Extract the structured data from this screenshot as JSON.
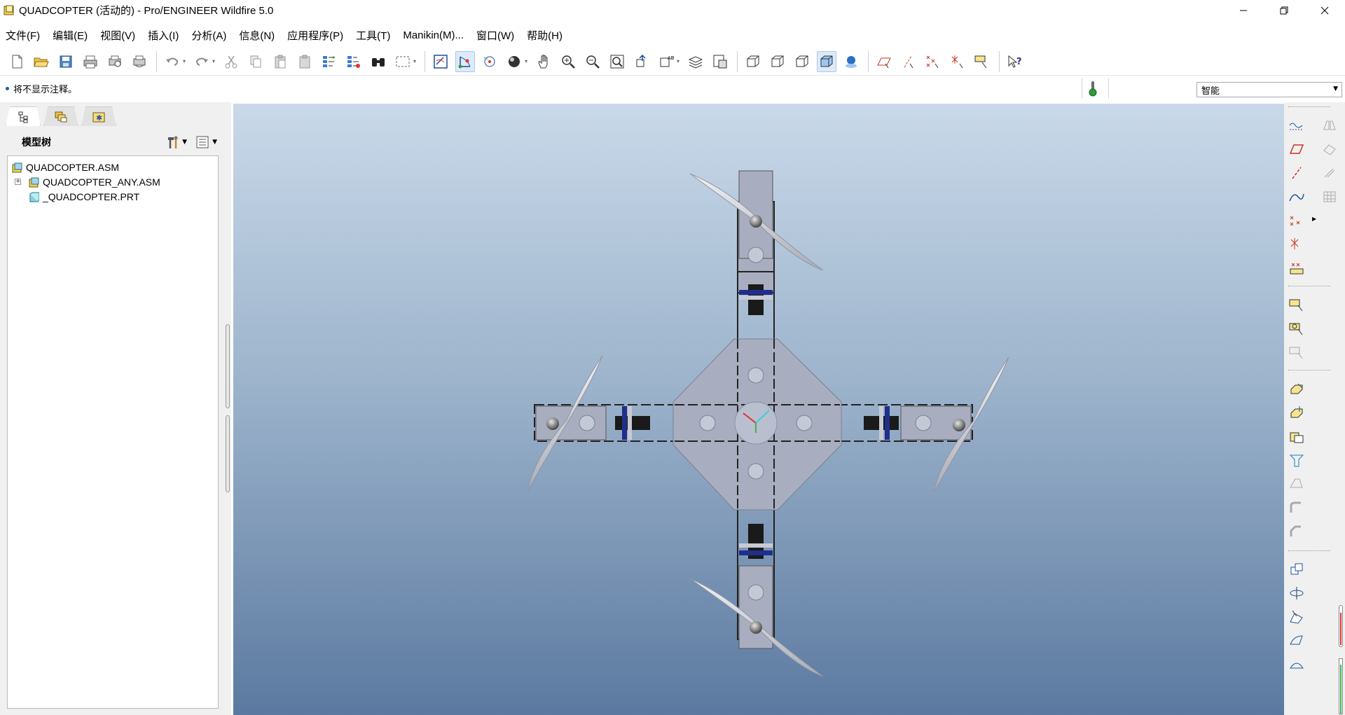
{
  "window": {
    "title": "QUADCOPTER (活动的) - Pro/ENGINEER Wildfire 5.0",
    "controls": [
      "minimize",
      "restore",
      "close"
    ]
  },
  "menu": {
    "items": [
      {
        "label": "文件(F)"
      },
      {
        "label": "编辑(E)"
      },
      {
        "label": "视图(V)"
      },
      {
        "label": "插入(I)"
      },
      {
        "label": "分析(A)"
      },
      {
        "label": "信息(N)"
      },
      {
        "label": "应用程序(P)"
      },
      {
        "label": "工具(T)"
      },
      {
        "label": "Manikin(M)..."
      },
      {
        "label": "窗口(W)"
      },
      {
        "label": "帮助(H)"
      }
    ]
  },
  "message_bar": {
    "message": "将不显示注释。",
    "filter": {
      "selected": "智能"
    }
  },
  "left_panel": {
    "tree_title": "模型树",
    "tree": [
      {
        "label": "QUADCOPTER.ASM",
        "type": "assembly"
      },
      {
        "label": "QUADCOPTER_ANY.ASM",
        "type": "assembly",
        "expandable": true
      },
      {
        "label": "_QUADCOPTER.PRT",
        "type": "part"
      }
    ]
  },
  "colors": {
    "viewport_top": "#c9d9e9",
    "viewport_bottom": "#5b79a0",
    "part_fill": "#a8aec0",
    "active_button": "#dcebf9"
  },
  "icons": {
    "toolbar": [
      "new-file-icon",
      "open-folder-icon",
      "save-icon",
      "print-icon",
      "print-preview-icon",
      "email-icon",
      "undo-icon",
      "redo-icon",
      "cut-icon",
      "copy-icon",
      "paste-icon",
      "paste-special-icon",
      "regenerate-icon",
      "regenerate-manager-icon",
      "find-icon",
      "select-box-icon",
      "sketch-view-icon",
      "datum-display-icon",
      "spin-center-icon",
      "appearance-icon",
      "pan-icon",
      "zoom-in-icon",
      "zoom-out-icon",
      "refit-icon",
      "reorient-icon",
      "saved-views-icon",
      "layers-icon",
      "view-manager-icon",
      "wireframe-icon",
      "hidden-line-icon",
      "no-hidden-icon",
      "shading-icon",
      "enhanced-realism-icon",
      "datum-planes-icon",
      "datum-axes-icon",
      "datum-points-icon",
      "coordinate-systems-icon",
      "annotations-icon",
      "context-help-icon"
    ],
    "right": [
      "sketch-curve-icon",
      "datum-plane-icon",
      "datum-axis-icon",
      "datum-curve-icon",
      "datum-point-icon",
      "datum-csys-icon",
      "analysis-feature-icon",
      "component-place-icon",
      "component-create-icon",
      "component-package-icon",
      "extrude-icon",
      "revolve-icon",
      "sweep-icon",
      "blend-icon",
      "hole-icon",
      "round-icon",
      "chamfer-icon",
      "shell-icon",
      "pattern-icon",
      "mirror-icon",
      "trim-icon",
      "offset-icon",
      "thicken-icon"
    ]
  }
}
